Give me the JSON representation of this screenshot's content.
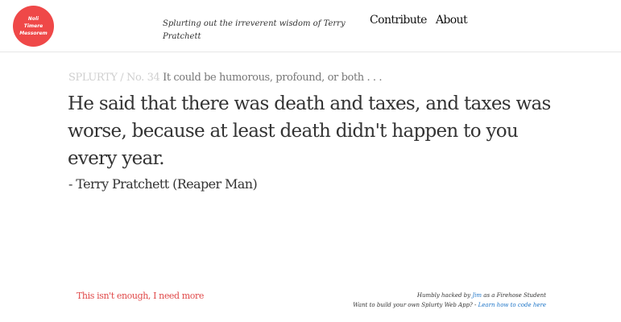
{
  "header": {
    "logo_lines": [
      "Noli",
      "Timere",
      "Messorem"
    ],
    "tagline": "Splurting out the irreverent wisdom of Terry Pratchett",
    "nav": [
      {
        "label": "Contribute"
      },
      {
        "label": "About"
      }
    ]
  },
  "splurty": {
    "number_label": "SPLURTY / No. 34",
    "subtitle": "It could be humorous, profound, or both . . .",
    "quote": "He said that there was death and taxes, and taxes was worse, because at least death didn't happen to you every year.",
    "author": "- Terry Pratchett (Reaper Man)"
  },
  "more_link": "This isn't enough, I need more",
  "footer": {
    "line1_prefix": "Humbly hacked by",
    "line1_link": "Jim",
    "line1_suffix": "as a Firehose Student",
    "line2_prefix": "Want to build your own Splurty Web App? -",
    "line2_link": "Learn how to code here"
  },
  "colors": {
    "logo_bg": "#ef4848",
    "more_link": "#e04848",
    "footer_link": "#1a73c7",
    "number_label": "#cfcfcf"
  }
}
